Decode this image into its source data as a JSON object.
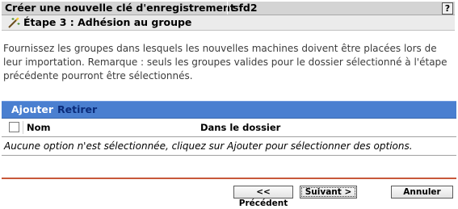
{
  "header": {
    "title": "Créer une nouvelle clé d'enregistrement",
    "key_name": "sfd2",
    "help_label": "?"
  },
  "step": {
    "icon": "wand-icon",
    "label": "Étape 3 : Adhésion au groupe"
  },
  "description": "Fournissez les groupes dans lesquels les nouvelles machines doivent être placées lors de leur importation. Remarque : seuls les groupes valides pour le dossier sélectionné à l'étape précédente pourront être sélectionnés.",
  "toolbar": {
    "add_label": "Ajouter",
    "remove_label": "Retirer"
  },
  "table": {
    "columns": [
      "Nom",
      "Dans le dossier"
    ],
    "empty_message": "Aucune option n'est sélectionnée, cliquez sur Ajouter pour sélectionner des options."
  },
  "footer": {
    "prev_label": "<< Précédent",
    "next_label": "Suivant >",
    "cancel_label": "Annuler"
  },
  "colors": {
    "toolbar_bg": "#4a7fd0",
    "divider": "#c8583a"
  }
}
